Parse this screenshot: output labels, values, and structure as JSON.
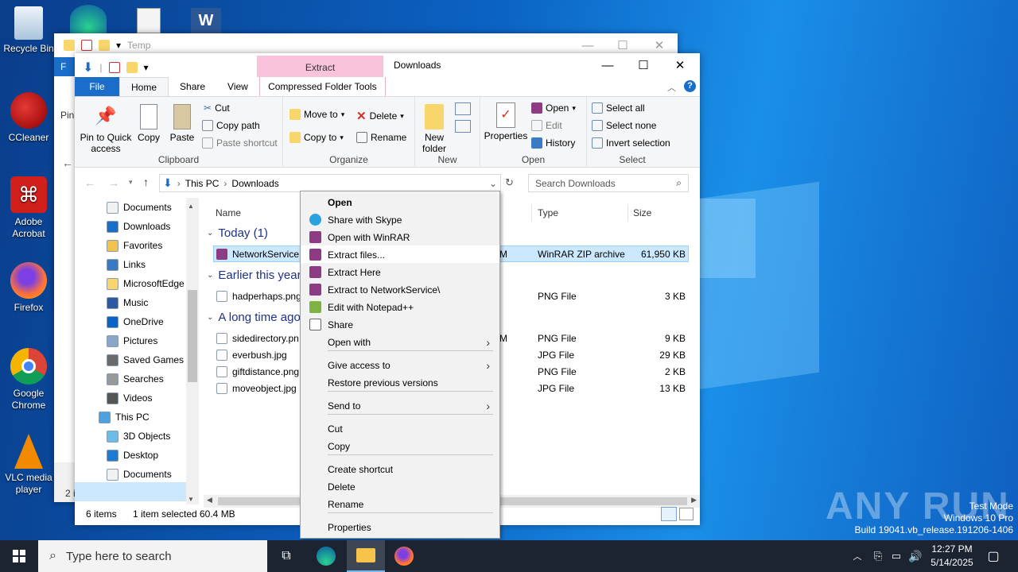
{
  "desktop": {
    "icons": [
      {
        "name": "recycle-bin",
        "label": "Recycle Bin"
      },
      {
        "name": "ccleaner",
        "label": "CCleaner"
      },
      {
        "name": "adobe-acrobat",
        "label": "Adobe Acrobat"
      },
      {
        "name": "firefox",
        "label": "Firefox"
      },
      {
        "name": "google-chrome",
        "label": "Google Chrome"
      },
      {
        "name": "vlc-media-player",
        "label": "VLC media player"
      }
    ],
    "watermark": {
      "brand": "ANY RUN",
      "line1": "Test Mode",
      "line2": "Windows 10 Pro",
      "line3": "Build 19041.vb_release.191206-1406"
    }
  },
  "back_window": {
    "title": "Temp",
    "tab_partial": "F",
    "pin_partial": "Pin",
    "status_partial": "2 i"
  },
  "explorer": {
    "context_tab_header": "Extract",
    "title": "Downloads",
    "tabs": [
      "File",
      "Home",
      "Share",
      "View",
      "Compressed Folder Tools"
    ],
    "active_tab": "Home",
    "clipboard": {
      "pin": "Pin to Quick access",
      "copy": "Copy",
      "paste": "Paste",
      "cut": "Cut",
      "copy_path": "Copy path",
      "paste_shortcut": "Paste shortcut",
      "label": "Clipboard"
    },
    "organize": {
      "move_to": "Move to",
      "copy_to": "Copy to",
      "delete": "Delete",
      "rename": "Rename",
      "label": "Organize"
    },
    "new": {
      "new_folder": "New folder",
      "label": "New"
    },
    "open": {
      "properties": "Properties",
      "open": "Open",
      "edit": "Edit",
      "history": "History",
      "label": "Open"
    },
    "select": {
      "select_all": "Select all",
      "select_none": "Select none",
      "invert": "Invert selection",
      "label": "Select"
    },
    "address": {
      "crumbs": [
        "This PC",
        "Downloads"
      ]
    },
    "search_placeholder": "Search Downloads",
    "tree": [
      "Documents",
      "Downloads",
      "Favorites",
      "Links",
      "MicrosoftEdge",
      "Music",
      "OneDrive",
      "Pictures",
      "Saved Games",
      "Searches",
      "Videos",
      "This PC",
      "3D Objects",
      "Desktop",
      "Documents",
      "Downloads"
    ],
    "columns": {
      "name": "Name",
      "type": "Type",
      "size": "Size"
    },
    "groups": [
      "Today (1)",
      "Earlier this year",
      "A long time ago"
    ],
    "files": [
      {
        "name": "NetworkService.",
        "date_tail": "M",
        "type": "WinRAR ZIP archive",
        "size": "61,950 KB"
      },
      {
        "name": "hadperhaps.png",
        "date_tail": "",
        "type": "PNG File",
        "size": "3 KB"
      },
      {
        "name": "sidedirectory.pn",
        "date_tail": "M",
        "type": "PNG File",
        "size": "9 KB"
      },
      {
        "name": "everbush.jpg",
        "date_tail": "",
        "type": "JPG File",
        "size": "29 KB"
      },
      {
        "name": "giftdistance.png",
        "date_tail": "",
        "type": "PNG File",
        "size": "2 KB"
      },
      {
        "name": "moveobject.jpg",
        "date_tail": "",
        "type": "JPG File",
        "size": "13 KB"
      }
    ],
    "status": {
      "items": "6 items",
      "selected": "1 item selected",
      "size": "60.4 MB"
    }
  },
  "context_menu": {
    "items": [
      "Open",
      "Share with Skype",
      "Open with WinRAR",
      "Extract files...",
      "Extract Here",
      "Extract to NetworkService\\",
      "Edit with Notepad++",
      "Share",
      "Open with",
      "Give access to",
      "Restore previous versions",
      "Send to",
      "Cut",
      "Copy",
      "Create shortcut",
      "Delete",
      "Rename",
      "Properties"
    ]
  },
  "taskbar": {
    "search_placeholder": "Type here to search",
    "time": "12:27 PM",
    "date": "5/14/2025"
  },
  "colors": {
    "accent": "#0078d7",
    "selection": "#cce8ff",
    "extract_tab": "#f9c3dc",
    "taskbar": "#1c2431"
  }
}
